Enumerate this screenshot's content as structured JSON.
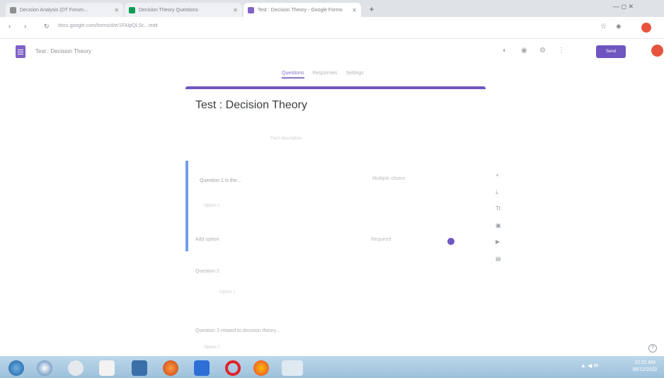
{
  "browser": {
    "tabs": [
      {
        "label": "Decision Analysis (DT Forum...",
        "color": "#8e8e8e"
      },
      {
        "label": "Decision Theory Questions",
        "color": "#0f9d58"
      },
      {
        "label": "Test : Decision Theory - Google Forms",
        "color": "#7f63c7"
      }
    ],
    "new_tab": "+",
    "url": "docs.google.com/forms/d/e/1FAIpQLSc.../edit",
    "window_controls": "— ◻ ✕"
  },
  "app": {
    "doc_title": "Test : Decision Theory",
    "send_label": "Send",
    "tabs": [
      "Questions",
      "Responses",
      "Settings"
    ]
  },
  "form": {
    "title": "Test : Decision Theory",
    "description": "Form description",
    "question1": {
      "text": "Question 1 is the...",
      "type": "Multiple choice",
      "option": "Option 1",
      "footer_left": "Add option",
      "footer_right": "Required"
    },
    "question2": {
      "text": "Question 2",
      "option": "Option 1"
    },
    "question3": {
      "text": "Question 3 related to decision theory...",
      "option": "Option 1"
    }
  },
  "sidebar_icons": [
    "+",
    "⤓",
    "Tt",
    "▣",
    "▶",
    "▤"
  ],
  "taskbar": {
    "tray": "▲ ◀ ✉",
    "time": "10:31 AM",
    "date": "06/12/2022"
  },
  "colors": {
    "accent": "#6f55c0",
    "question_border": "#6f9ef0",
    "taskbar": "#9cc1db"
  }
}
